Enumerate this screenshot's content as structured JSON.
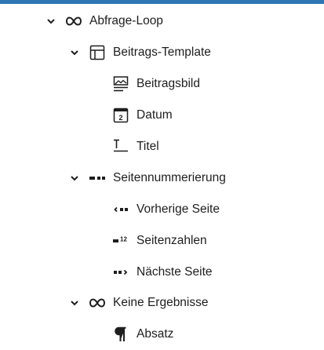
{
  "list_view": {
    "items": [
      {
        "label": "Abfrage-Loop",
        "icon": "loop-icon",
        "expanded": true
      },
      {
        "label": "Beitrags-Template",
        "icon": "layout-icon",
        "expanded": true
      },
      {
        "label": "Beitragsbild",
        "icon": "featured-image-icon"
      },
      {
        "label": "Datum",
        "icon": "calendar-icon",
        "date_number": "2"
      },
      {
        "label": "Titel",
        "icon": "title-icon"
      },
      {
        "label": "Seitennummerierung",
        "icon": "pagination-icon",
        "expanded": true
      },
      {
        "label": "Vorherige Seite",
        "icon": "previous-page-icon"
      },
      {
        "label": "Seitenzahlen",
        "icon": "page-numbers-icon",
        "numbers": "12"
      },
      {
        "label": "Nächste Seite",
        "icon": "next-page-icon"
      },
      {
        "label": "Keine Ergebnisse",
        "icon": "loop-icon",
        "expanded": true
      },
      {
        "label": "Absatz",
        "icon": "paragraph-icon"
      }
    ]
  },
  "colors": {
    "accent_bar": "#2d75b4",
    "text": "#1e1e1e"
  }
}
